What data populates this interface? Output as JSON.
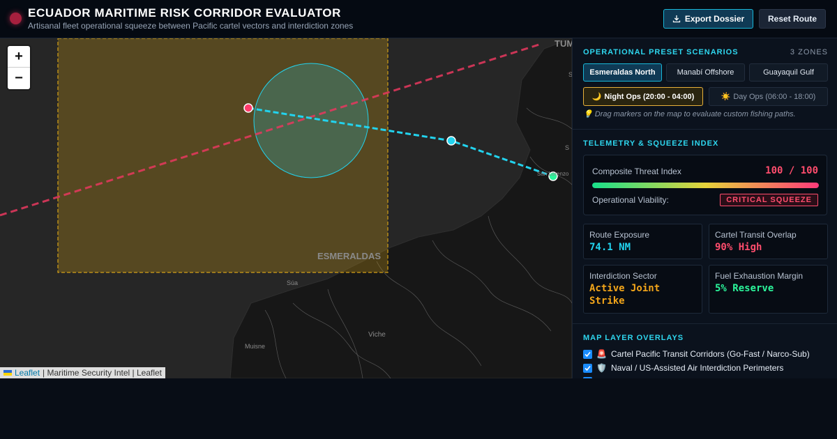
{
  "header": {
    "title": "ECUADOR MARITIME RISK CORRIDOR EVALUATOR",
    "subtitle": "Artisanal fleet operational squeeze between Pacific cartel vectors and interdiction zones",
    "export_label": "Export Dossier",
    "reset_label": "Reset Route"
  },
  "map": {
    "zoom_in": "+",
    "zoom_out": "−",
    "labels": {
      "esmeraldas": "ESMERALDAS",
      "tumaco": "TUM",
      "sua": "Súa",
      "muisne": "Muisne",
      "viche": "Viche",
      "san_lorenzo": "San Lorenzo",
      "edge_s1": "S",
      "edge_s2": "S"
    },
    "attribution": {
      "leaflet": "Leaflet",
      "rest": "| Maritime Security Intel | Leaflet"
    },
    "colors": {
      "cartel_corridor": "#e8385f",
      "route": "#22d3ee",
      "interdiction": "#d4a017",
      "start_marker": "#ff3b6b",
      "end_marker": "#2bf59b"
    }
  },
  "scenarios": {
    "title": "OPERATIONAL PRESET SCENARIOS",
    "zones": "3 ZONES",
    "presets": [
      "Esmeraldas North",
      "Manabí Offshore",
      "Guayaquil Gulf"
    ],
    "night_ops": "Night Ops (20:00 - 04:00)",
    "day_ops": "Day Ops (06:00 - 18:00)",
    "hint": "Drag markers on the map to evaluate custom fishing paths."
  },
  "telemetry": {
    "title": "TELEMETRY & SQUEEZE INDEX",
    "threat_label": "Composite Threat Index",
    "threat_value": "100 / 100",
    "threat_fraction": 1.0,
    "viability_label": "Operational Viability:",
    "viability_badge": "CRITICAL SQUEEZE",
    "metrics": [
      {
        "label": "Route Exposure",
        "value": "74.1 NM",
        "color": "#22d3ee"
      },
      {
        "label": "Cartel Transit Overlap",
        "value": "90% High",
        "color": "#ff4d6d"
      },
      {
        "label": "Interdiction Sector",
        "value": "Active Joint Strike",
        "color": "#f2a51a"
      },
      {
        "label": "Fuel Exhaustion Margin",
        "value": "5% Reserve",
        "color": "#2bf59b"
      }
    ]
  },
  "layers": {
    "title": "MAP LAYER OVERLAYS",
    "items": [
      {
        "label": "Cartel Pacific Transit Corridors (Go-Fast / Narco-Sub)",
        "icon": "🚨"
      },
      {
        "label": "Naval / US-Assisted Air Interdiction Perimeters",
        "icon": "🛡️"
      }
    ]
  }
}
